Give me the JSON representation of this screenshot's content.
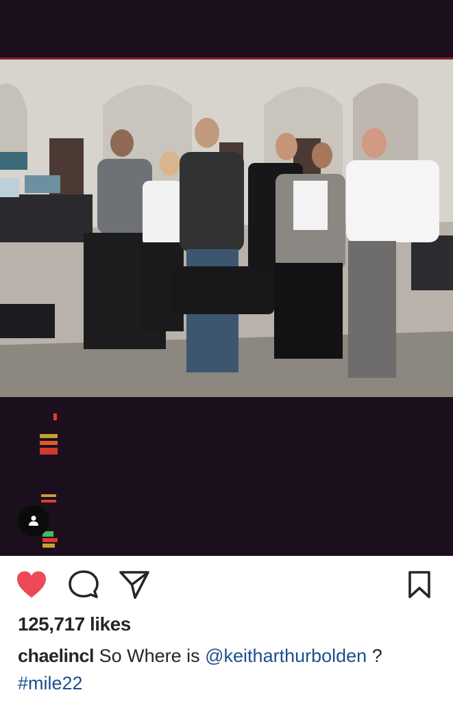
{
  "post": {
    "media": {
      "subject": "cast-and-crew-group-photo",
      "vhs_overlay": {
        "top_label": "88",
        "mid_label": "==",
        "bottom_label": "4"
      },
      "tag_icon": "user-tag-icon"
    },
    "actions": {
      "like": {
        "icon": "heart-icon",
        "liked": true,
        "color": "#ed4956"
      },
      "comment": {
        "icon": "comment-icon"
      },
      "share": {
        "icon": "paper-plane-icon"
      },
      "save": {
        "icon": "bookmark-icon"
      }
    },
    "likes_text": "125,717 likes",
    "caption": {
      "username": "chaelincl",
      "text_before": " So Where is ",
      "mention": "@keitharthurbolden",
      "text_after": " ?",
      "hashtag": "#mile22"
    }
  },
  "colors": {
    "link": "#1c4f8e",
    "text": "#262626",
    "media_bg": "#1b0f1e"
  }
}
